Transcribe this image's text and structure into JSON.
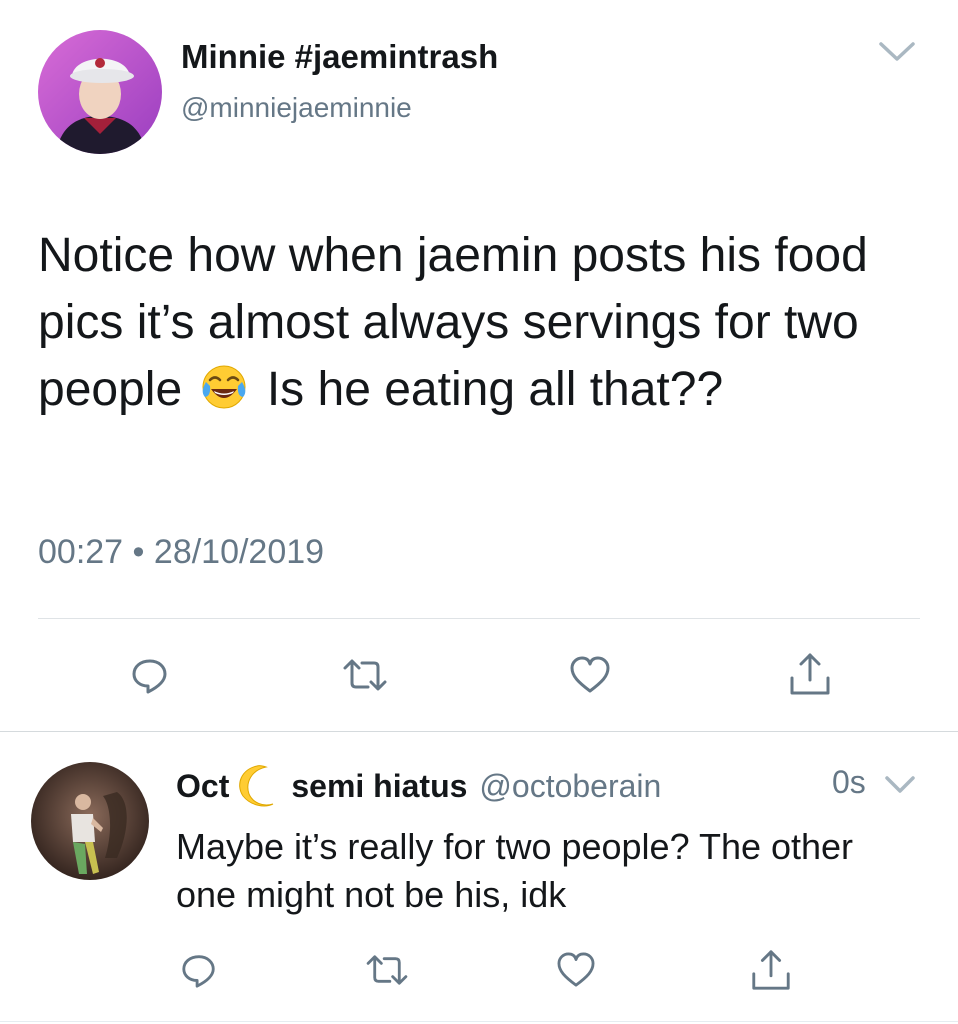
{
  "tweet": {
    "author_name": "Minnie #jaemintrash",
    "author_handle": "@minniejaeminnie",
    "text_part1": "Notice how when jaemin posts his food pics it’s almost always servings for two people",
    "emoji": "face-with-tears-of-joy",
    "text_part2": "Is he eating all that??",
    "time": "00:27",
    "separator": "•",
    "date": "28/10/2019",
    "actions": [
      "reply-icon",
      "retweet-icon",
      "like-icon",
      "share-icon"
    ]
  },
  "reply": {
    "author_name_part1": "Oct",
    "author_name_emoji": "crescent-moon",
    "author_name_part2": "semi hiatus",
    "author_handle": "@octoberain",
    "time": "0s",
    "text": "Maybe it’s really for two people? The other one might not be his, idk",
    "actions": [
      "reply-icon",
      "retweet-icon",
      "like-icon",
      "share-icon"
    ]
  },
  "colors": {
    "text_primary": "#14171a",
    "text_secondary": "#657786",
    "divider": "#dfe3e6"
  }
}
